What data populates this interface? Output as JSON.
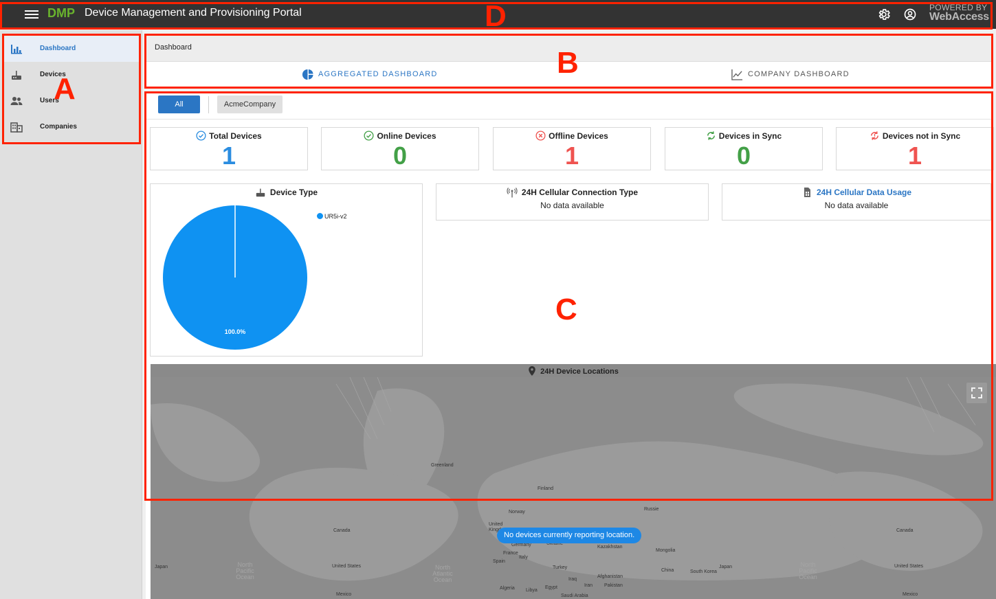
{
  "header": {
    "brand": "DMP",
    "title": "Device Management and Provisioning Portal",
    "powered_by_line1": "POWERED BY",
    "powered_by_line2": "WebAccess",
    "icons": [
      "menu-icon",
      "gear-icon",
      "account-circle-icon"
    ]
  },
  "sidebar": {
    "items": [
      {
        "label": "Dashboard",
        "icon": "bar-chart-icon",
        "active": true
      },
      {
        "label": "Devices",
        "icon": "router-icon"
      },
      {
        "label": "Users",
        "icon": "users-icon"
      },
      {
        "label": "Companies",
        "icon": "building-icon"
      }
    ]
  },
  "breadcrumb": "Dashboard",
  "tabs": [
    {
      "label": "AGGREGATED DASHBOARD",
      "icon": "pie-chart-icon",
      "active": true
    },
    {
      "label": "COMPANY DASHBOARD",
      "icon": "line-chart-icon"
    }
  ],
  "filters": {
    "all_label": "All",
    "company_label": "AcmeCompany"
  },
  "stats": [
    {
      "label": "Total Devices",
      "value": "1",
      "color": "#2b8de0",
      "icon": "check-circle-icon"
    },
    {
      "label": "Online Devices",
      "value": "0",
      "color": "#43a047",
      "icon": "check-circle-icon"
    },
    {
      "label": "Offline Devices",
      "value": "1",
      "color": "#ef5350",
      "icon": "x-circle-icon"
    },
    {
      "label": "Devices in Sync",
      "value": "0",
      "color": "#43a047",
      "icon": "sync-icon"
    },
    {
      "label": "Devices not in Sync",
      "value": "1",
      "color": "#ef5350",
      "icon": "sync-problem-icon"
    }
  ],
  "cards": {
    "device_type": {
      "title": "Device Type",
      "icon": "router-icon"
    },
    "cellular_conn": {
      "title": "24H Cellular Connection Type",
      "empty": "No data available",
      "icon": "antenna-icon"
    },
    "cellular_usage": {
      "title": "24H Cellular Data Usage",
      "empty": "No data available",
      "icon": "sim-card-icon"
    }
  },
  "chart_data": {
    "type": "pie",
    "title": "Device Type",
    "categories": [
      "UR5i-v2"
    ],
    "values": [
      100.0
    ],
    "labels": [
      "100.0%"
    ],
    "colors": [
      "#0f92f2"
    ],
    "legend_position": "top-right"
  },
  "map": {
    "title": "24H Device Locations",
    "icon": "location-pin-icon",
    "message": "No devices currently reporting location.",
    "labels": [
      "Greenland",
      "Finland",
      "Norway",
      "Russie",
      "Canada",
      "United Kingdom",
      "Germany",
      "Ukraine",
      "Kazakhstan",
      "Mongolia",
      "France",
      "Spain",
      "Italy",
      "Turkey",
      "China",
      "South Korea",
      "Japan",
      "Afghanistan",
      "Pakistan",
      "Iraq",
      "Iran",
      "Egypt",
      "Libya",
      "Algeria",
      "Saudi Arabia",
      "United States",
      "Mexico"
    ],
    "oceans": [
      "North Pacific Ocean",
      "North Atlantic Ocean"
    ]
  },
  "annotations": [
    "A",
    "B",
    "C",
    "D"
  ]
}
